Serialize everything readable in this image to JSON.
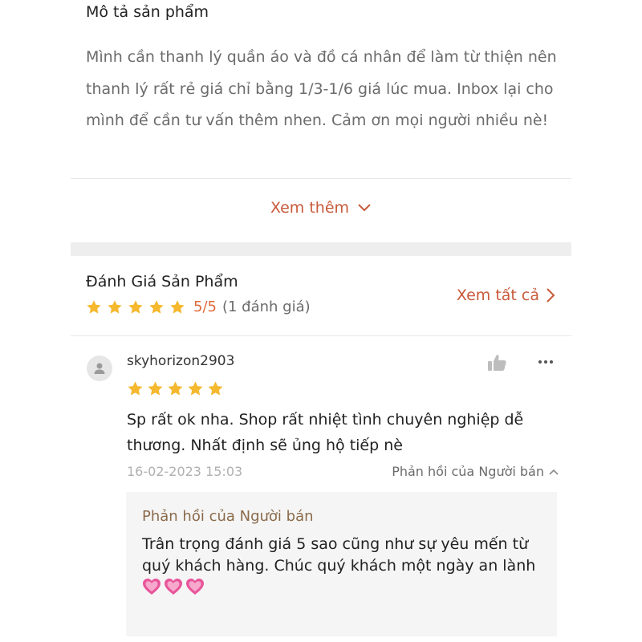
{
  "description": {
    "title": "Mô tả sản phẩm",
    "body": "Mình cần thanh lý quần áo và đồ cá nhân để làm từ thiện nên thanh lý rất rẻ giá chỉ bằng 1/3-1/6 giá lúc mua. Inbox lại cho mình để cần tư vấn thêm nhen. Cảm ơn mọi người nhiều nè!",
    "see_more_label": "Xem thêm"
  },
  "reviews": {
    "title": "Đánh Giá Sản Phẩm",
    "rating_score": "5/5",
    "rating_count_text": "(1 đánh giá)",
    "rating_value": 5,
    "see_all_label": "Xem tất cả",
    "items": [
      {
        "username": "skyhorizon2903",
        "stars": 5,
        "text": "Sp rất ok nha. Shop rất nhiệt tình chuyên nghiệp dễ thương. Nhất định sẽ ủng hộ tiếp nè",
        "date": "16-02-2023 15:03",
        "reply_toggle_label": "Phản hồi của Người bán",
        "reply": {
          "title": "Phản hồi của Người bán",
          "text": "Trân trọng đánh giá 5 sao cũng như sự yêu mến từ quý khách hàng. Chúc quý khách một ngày an lành",
          "emoji_count": 3
        }
      }
    ]
  },
  "colors": {
    "accent": "#c85a3a",
    "star": "#f5b82e",
    "heart": "#e8559a"
  },
  "icons": [
    "chevron-down-icon",
    "chevron-right-icon",
    "star-icon",
    "user-icon",
    "thumbs-up-icon",
    "more-icon",
    "chevron-up-icon",
    "heart-icon"
  ]
}
